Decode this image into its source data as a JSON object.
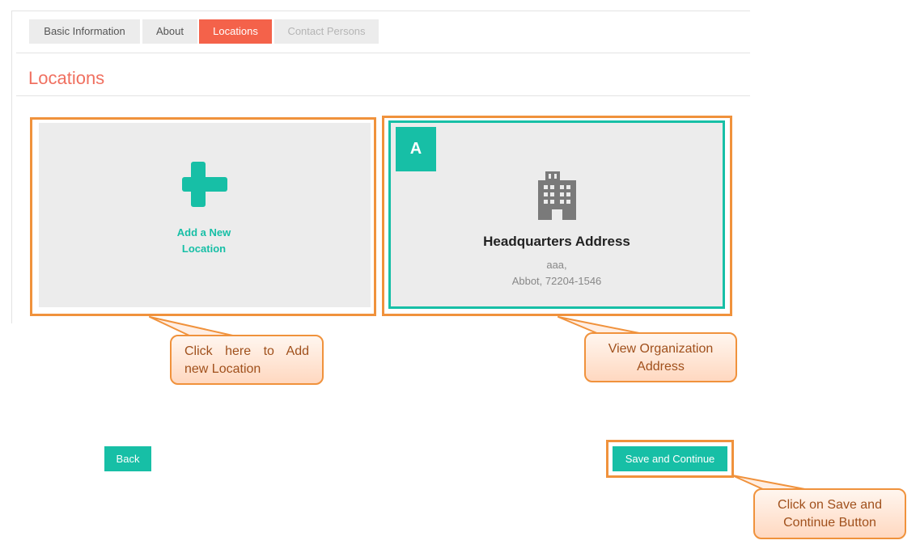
{
  "tabs": [
    {
      "label": "Basic Information"
    },
    {
      "label": "About"
    },
    {
      "label": "Locations"
    },
    {
      "label": "Contact Persons"
    }
  ],
  "page": {
    "title": "Locations"
  },
  "add_card": {
    "label_line1": "Add a New",
    "label_line2": "Location",
    "icon": "plus-icon"
  },
  "address_card": {
    "badge": "A",
    "icon": "building-icon",
    "title": "Headquarters Address",
    "line1": "aaa,",
    "line2": "Abbot, 72204-1546"
  },
  "callouts": {
    "add": "Click here to Add new Location",
    "view_line1": "View Organization",
    "view_line2": "Address",
    "save_line1": "Click on Save and",
    "save_line2": "Continue Button"
  },
  "buttons": {
    "back": "Back",
    "save": "Save and Continue"
  },
  "colors": {
    "accent": "#17bfa6",
    "active_tab": "#f4624a",
    "highlight_frame": "#f0923c"
  }
}
